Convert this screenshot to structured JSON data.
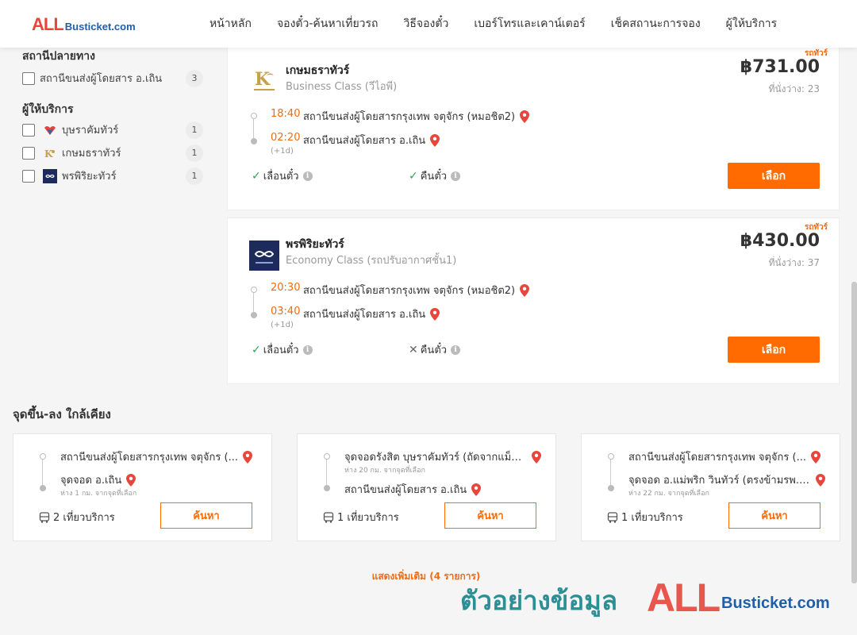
{
  "header": {
    "logo_all": "ALL",
    "logo_rest": "Busticket.com",
    "nav": [
      "หน้าหลัก",
      "จองตั๋ว-ค้นหาเที่ยวรถ",
      "วิธีจองตั๋ว",
      "เบอร์โทรและเคาน์เตอร์",
      "เช็คสถานะการจอง",
      "ผู้ให้บริการ"
    ]
  },
  "sidebar": {
    "destination_title": "สถานีปลายทาง",
    "destinations": [
      {
        "label": "สถานีขนส่งผู้โดยสาร อ.เถิน",
        "count": "3"
      }
    ],
    "operators_title": "ผู้ให้บริการ",
    "operators": [
      {
        "label": "บุษราคัมทัวร์",
        "count": "1"
      },
      {
        "label": "เกษมธราทัวร์",
        "count": "1"
      },
      {
        "label": "พรพิริยะทัวร์",
        "count": "1"
      }
    ]
  },
  "trips": [
    {
      "ribbon": "รถทัวร์",
      "operator": "เกษมธราทัวร์",
      "bus_class": "Business Class (วีไอพี)",
      "price": "฿731.00",
      "seats": "ที่นั่งว่าง: 23",
      "depart_time": "18:40",
      "depart_station": "สถานีขนส่งผู้โดยสารกรุงเทพ จตุจักร (หมอชิต2)",
      "arrive_time": "02:20",
      "arrive_station": "สถานีขนส่งผู้โดยสาร อ.เถิน",
      "next_day": "(+1d)",
      "reschedule": "เลื่อนตั๋ว",
      "refund": "คืนตั๋ว",
      "select": "เลือก"
    },
    {
      "ribbon": "รถทัวร์",
      "operator": "พรพิริยะทัวร์",
      "bus_class": "Economy Class (รถปรับอากาศชั้น1)",
      "price": "฿430.00",
      "seats": "ที่นั่งว่าง: 37",
      "depart_time": "20:30",
      "depart_station": "สถานีขนส่งผู้โดยสารกรุงเทพ จตุจักร (หมอชิต2)",
      "arrive_time": "03:40",
      "arrive_station": "สถานีขนส่งผู้โดยสาร อ.เถิน",
      "next_day": "(+1d)",
      "reschedule": "เลื่อนตั๋ว",
      "refund": "คืนตั๋ว",
      "select": "เลือก"
    }
  ],
  "nearby": {
    "title": "จุดขึ้น-ลง ใกล้เคียง",
    "cards": [
      {
        "from": "สถานีขนส่งผู้โดยสารกรุงเทพ จตุจักร (...",
        "from_dist": "",
        "to": "จุดจอด อ.เถิน",
        "to_dist": "ห่าง 1 กม. จากจุดที่เลือก",
        "trips": "2 เที่ยวบริการ",
        "button": "ค้นหา"
      },
      {
        "from": "จุดจอดรังสิต บุษราคัมทัวร์ (ถัดจากแม็ค...",
        "from_dist": "ห่าง 20 กม. จากจุดที่เลือก",
        "to": "สถานีขนส่งผู้โดยสาร อ.เถิน",
        "to_dist": "",
        "trips": "1 เที่ยวบริการ",
        "button": "ค้นหา"
      },
      {
        "from": "สถานีขนส่งผู้โดยสารกรุงเทพ จตุจักร (...",
        "from_dist": "",
        "to": "จุดจอด อ.แม่พริก วินทัวร์ (ตรงข้ามรพ.แ...",
        "to_dist": "ห่าง 22 กม. จากจุดที่เลือก",
        "trips": "1 เที่ยวบริการ",
        "button": "ค้นหา"
      }
    ]
  },
  "show_more": "แสดงเพิ่มเติม (4 รายการ)",
  "watermark": {
    "text": "ตัวอย่างข้อมูล",
    "all": "ALL",
    "rest": "Busticket.com"
  },
  "colors": {
    "accent": "#ff6b00",
    "time": "#f26b0f",
    "check": "#2ea44f",
    "pin": "#e8453c",
    "logo_red": "#e8453c",
    "logo_blue": "#1f5fa8"
  }
}
